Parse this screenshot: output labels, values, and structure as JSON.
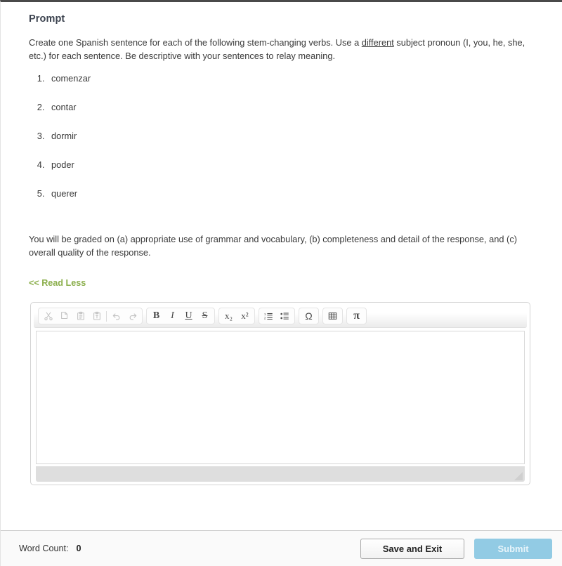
{
  "page": {
    "title": "Prompt"
  },
  "prompt": {
    "intro_before_underline": "Create one Spanish sentence for each of the following stem-changing verbs. Use a ",
    "underlined_word": "different",
    "intro_after_underline": " subject pronoun (I, you, he, she, etc.) for each sentence. Be descriptive with your sentences to relay meaning.",
    "verbs": [
      "comenzar",
      "contar",
      "dormir",
      "poder",
      "querer"
    ],
    "grading_note": "You will be graded on (a) appropriate use of grammar and vocabulary, (b) completeness and detail of the response, and (c) overall quality of the response.",
    "read_less_label": "<< Read Less"
  },
  "editor": {
    "content": "",
    "placeholder": "",
    "toolbar": {
      "cut": "cut-icon",
      "copy": "copy-icon",
      "paste": "paste-icon",
      "paste_text": "paste-as-text-icon",
      "undo": "undo-icon",
      "redo": "redo-icon",
      "bold": "B",
      "italic": "I",
      "underline": "U",
      "strikethrough": "S",
      "subscript": "x₂",
      "superscript": "x²",
      "numbered_list": "numbered-list-icon",
      "bulleted_list": "bulleted-list-icon",
      "special_character": "Ω",
      "table": "table-icon",
      "math": "π"
    }
  },
  "footer": {
    "word_count_label": "Word Count:",
    "word_count_value": "0",
    "save_exit_label": "Save and Exit",
    "submit_label": "Submit"
  },
  "colors": {
    "read_less_green": "#8aae4a",
    "submit_blue": "#92cbe4",
    "title_slate": "#3d4450"
  }
}
